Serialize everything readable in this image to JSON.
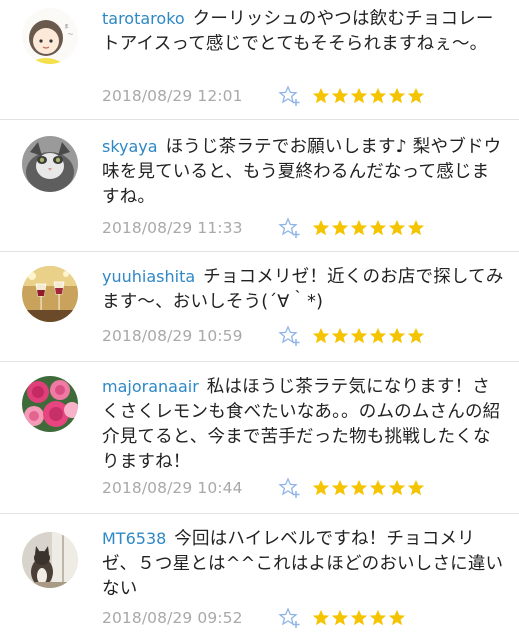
{
  "comments": [
    {
      "username": "tarotaroko",
      "text": "クーリッシュのやつは飲むチョコレートアイスって感じでとてもそそられますねぇ〜。",
      "timestamp": "2018/08/29 12:01",
      "stars": 6,
      "avatar": "illustrated-girl-avatar"
    },
    {
      "username": "skyaya",
      "text": "ほうじ茶ラテでお願いします♪ 梨やブドウ味を見ていると、もう夏終わるんだなって感じますね。",
      "timestamp": "2018/08/29 11:33",
      "stars": 6,
      "avatar": "cat-photo-avatar"
    },
    {
      "username": "yuuhiashita",
      "text": "チョコメリゼ！近くのお店で探してみます〜、おいしそう(´∀｀*)",
      "timestamp": "2018/08/29 10:59",
      "stars": 6,
      "avatar": "wine-glasses-avatar"
    },
    {
      "username": "majoranaair",
      "text": "私はほうじ茶ラテ気になります！さくさくレモンも食べたいなあ。。のムのムさんの紹介見てると、今まで苦手だった物も挑戦したくなりますね！",
      "timestamp": "2018/08/29 10:44",
      "stars": 6,
      "avatar": "pink-roses-avatar"
    },
    {
      "username": "MT6538",
      "text": "今回はハイレベルですね！チョコメリゼ、５つ星とは^^これはよほどのおいしさに違いない",
      "timestamp": "2018/08/29 09:52",
      "stars": 5,
      "avatar": "cat-window-avatar"
    }
  ],
  "colors": {
    "username": "#2e88c6",
    "timestamp": "#a9a9a9",
    "star": "#f5c400",
    "fav_icon": "#8fb4e8",
    "divider": "#e2e2e2"
  },
  "icons": {
    "fav": "favorite-star-add-icon",
    "rating": "rating-star-icon"
  }
}
